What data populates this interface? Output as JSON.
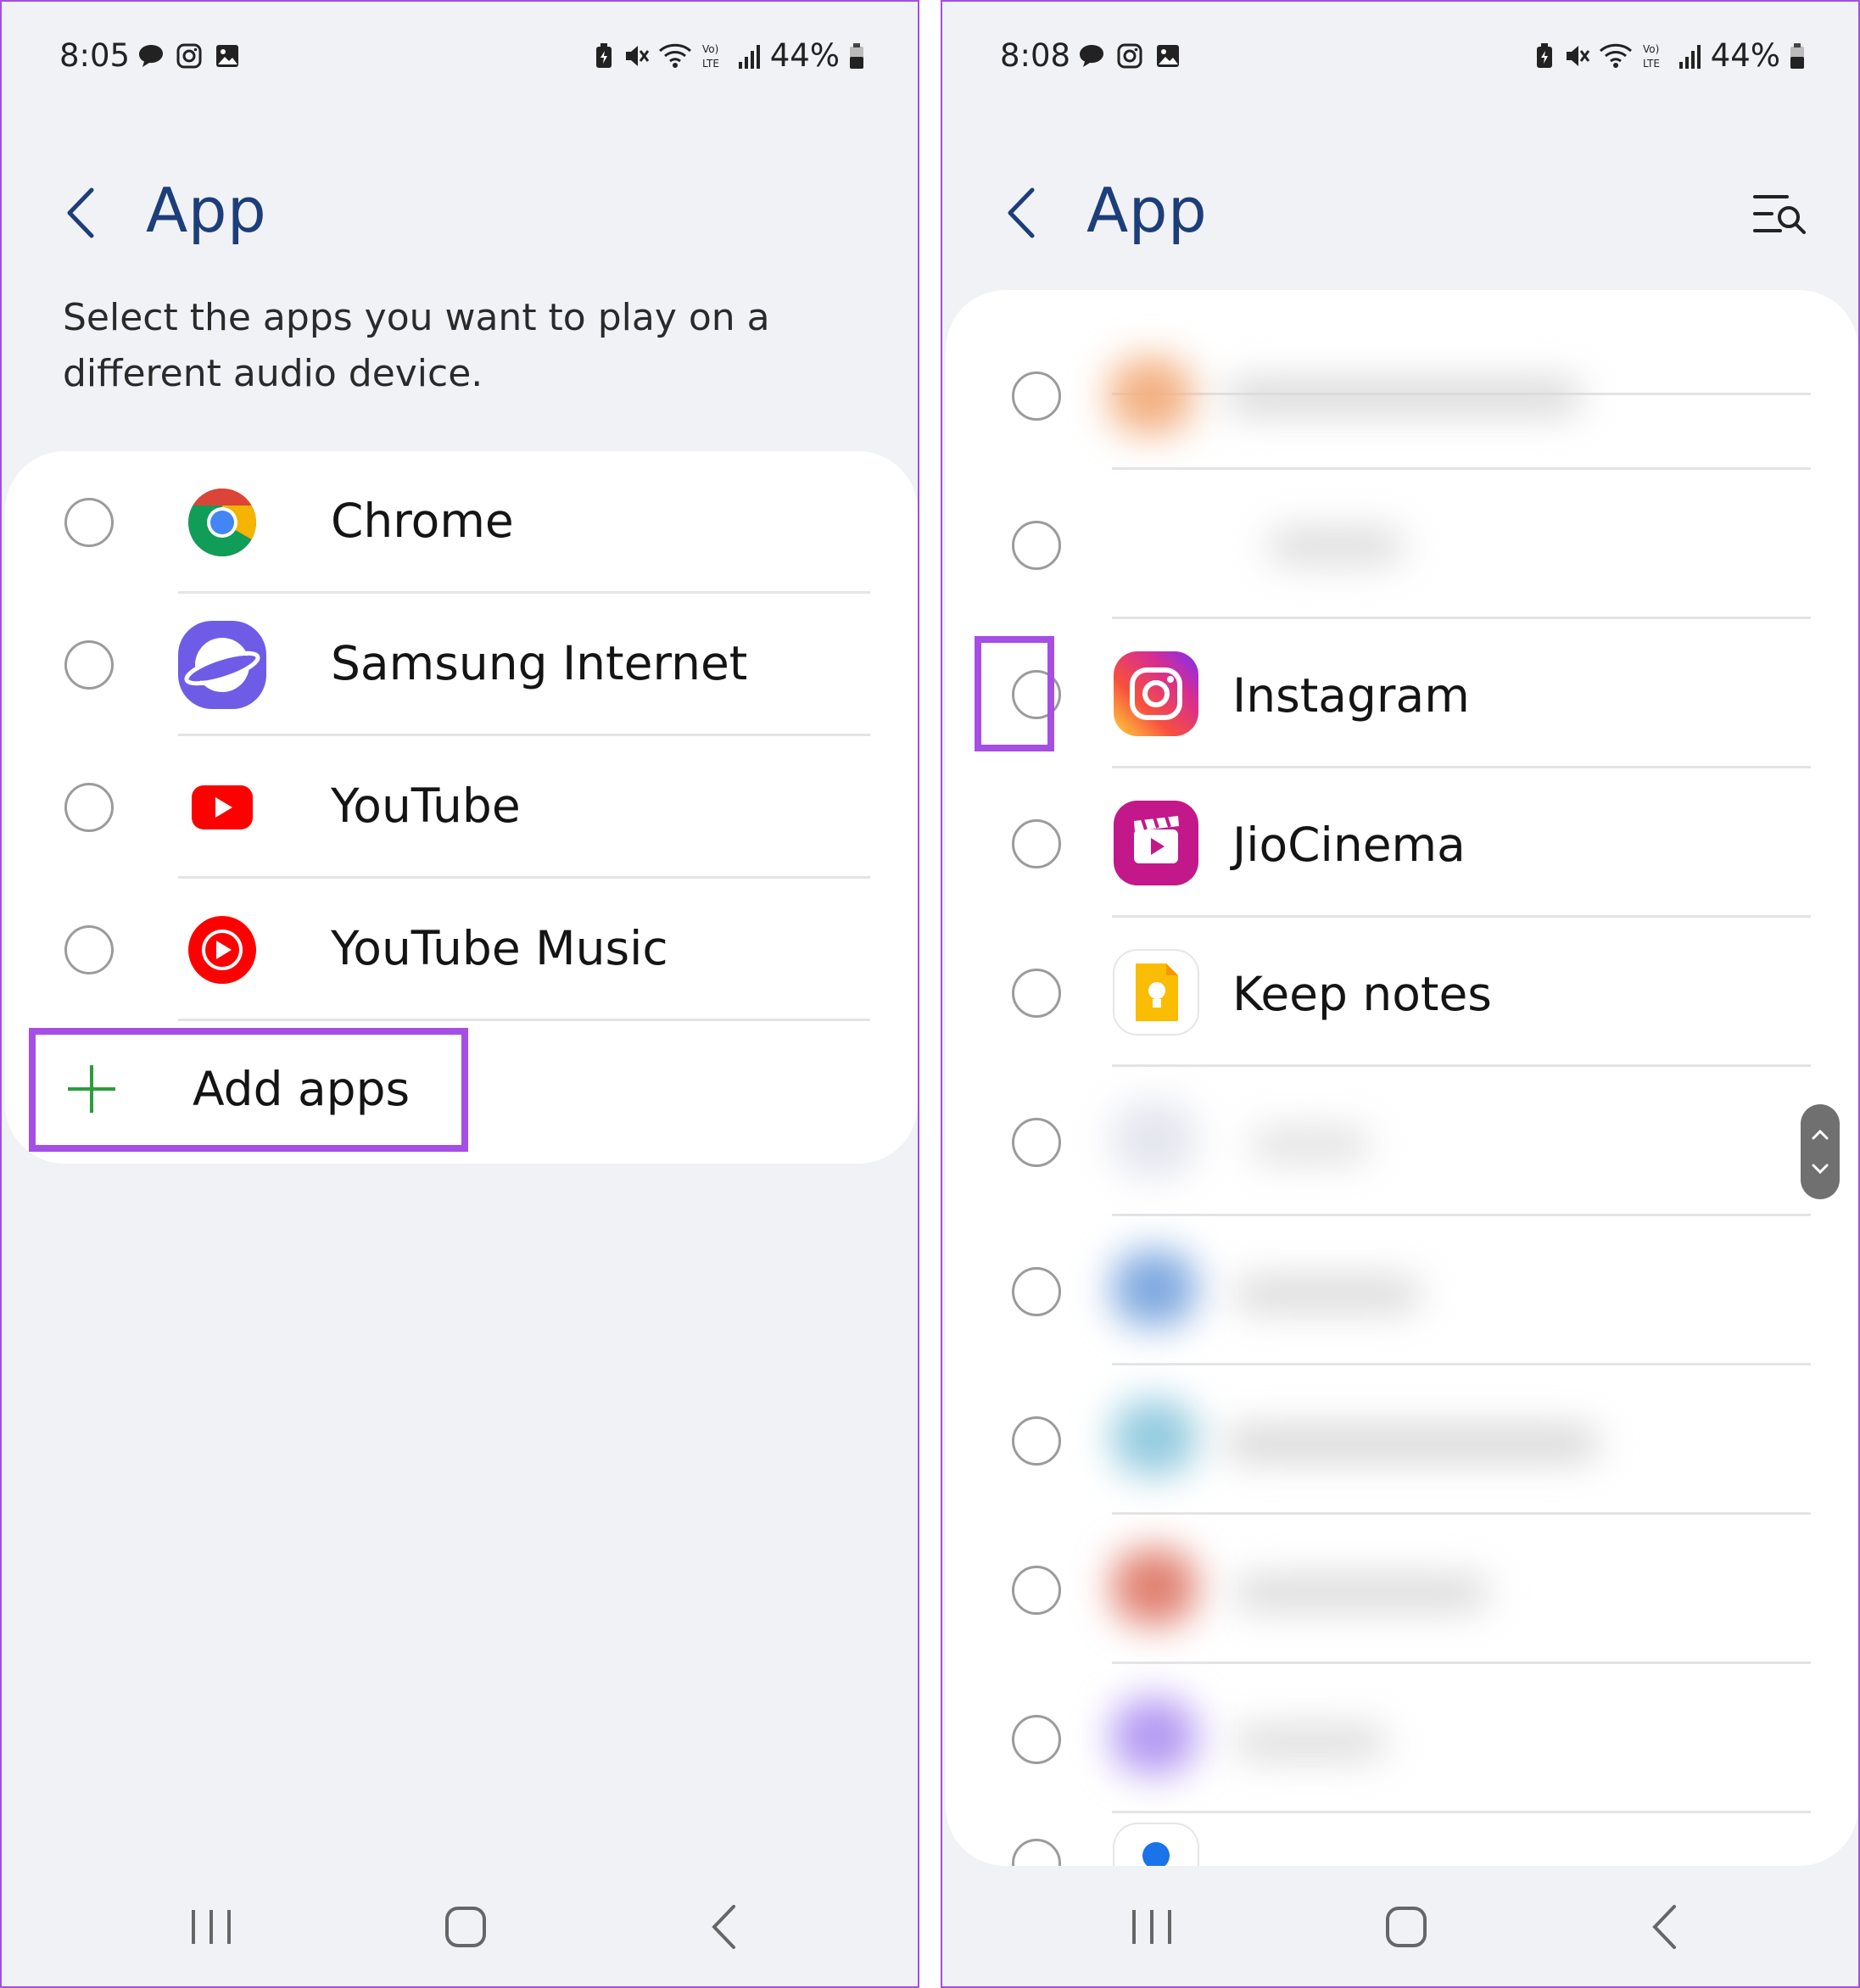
{
  "left_screen": {
    "status_bar": {
      "time": "8:05",
      "battery": "44%"
    },
    "header": {
      "title": "App"
    },
    "description": "Select the apps you want to play on a different audio device.",
    "apps": [
      {
        "label": "Chrome",
        "icon": "chrome-icon"
      },
      {
        "label": "Samsung Internet",
        "icon": "samsung-internet-icon"
      },
      {
        "label": "YouTube",
        "icon": "youtube-icon"
      },
      {
        "label": "YouTube Music",
        "icon": "youtube-music-icon"
      }
    ],
    "add_apps_label": "Add apps"
  },
  "right_screen": {
    "status_bar": {
      "time": "8:08",
      "battery": "44%"
    },
    "header": {
      "title": "App"
    },
    "apps": [
      {
        "label": "Instagram",
        "icon": "instagram-icon"
      },
      {
        "label": "JioCinema",
        "icon": "jiocinema-icon"
      },
      {
        "label": "Keep notes",
        "icon": "keep-notes-icon"
      }
    ]
  },
  "colors": {
    "highlight": "#a54ee6",
    "title": "#1c3e7a",
    "background": "#f1f2f6",
    "add_plus": "#2a9d3a"
  }
}
